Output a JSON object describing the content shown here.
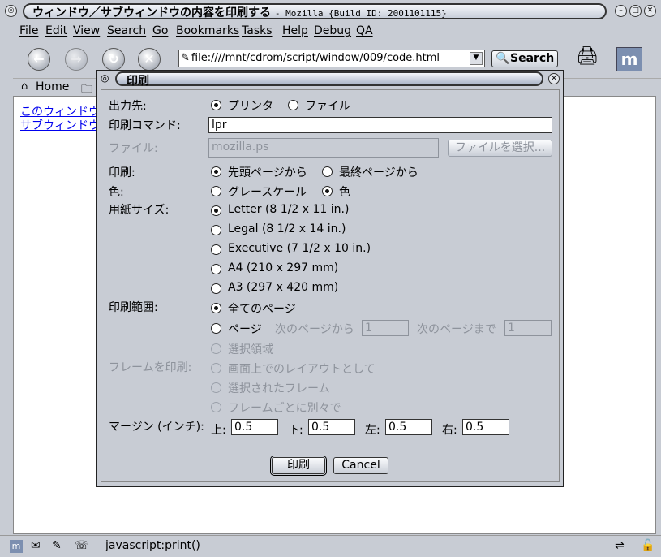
{
  "window": {
    "title": "ウィンドウ／サブウィンドウの内容を印刷する",
    "title_suffix": "- Mozilla {Build ID: 2001101115}"
  },
  "menu": [
    "File",
    "Edit",
    "View",
    "Search",
    "Go",
    "Bookmarks",
    "Tasks",
    "Help",
    "Debug",
    "QA"
  ],
  "toolbar": {
    "url": "file:////mnt/cdrom/script/window/009/code.html",
    "search_label": "Search"
  },
  "personal": {
    "home_label": "Home"
  },
  "page": {
    "links": [
      "このウィンドウ",
      "サブウィンドウ"
    ]
  },
  "status": {
    "text": "javascript:print()"
  },
  "dialog": {
    "title": "印刷",
    "dest_label": "出力先:",
    "dest_printer": "プリンタ",
    "dest_file": "ファイル",
    "cmd_label": "印刷コマンド:",
    "cmd_value": "lpr",
    "file_label": "ファイル:",
    "file_value": "mozilla.ps",
    "file_choose": "ファイルを選択...",
    "order_label": "印刷:",
    "order_first": "先頭ページから",
    "order_last": "最終ページから",
    "color_label": "色:",
    "color_gray": "グレースケール",
    "color_color": "色",
    "paper_label": "用紙サイズ:",
    "paper_options": [
      "Letter (8 1/2 x 11 in.)",
      "Legal (8 1/2 x 14 in.)",
      "Executive (7 1/2 x 10 in.)",
      "A4 (210 x 297 mm)",
      "A3 (297 x 420 mm)"
    ],
    "range_label": "印刷範囲:",
    "range_all": "全てのページ",
    "range_pages": "ページ",
    "range_from": "次のページから",
    "range_from_value": "1",
    "range_to": "次のページまで",
    "range_to_value": "1",
    "range_selection": "選択領域",
    "frames_label": "フレームを印刷:",
    "frames_opts": [
      "画面上でのレイアウトとして",
      "選択されたフレーム",
      "フレームごとに別々で"
    ],
    "margin_label": "マージン (インチ):",
    "margin_top_label": "上:",
    "margin_top": "0.5",
    "margin_bottom_label": "下:",
    "margin_bottom": "0.5",
    "margin_left_label": "左:",
    "margin_left": "0.5",
    "margin_right_label": "右:",
    "margin_right": "0.5",
    "print_button": "印刷",
    "cancel_button": "Cancel"
  }
}
